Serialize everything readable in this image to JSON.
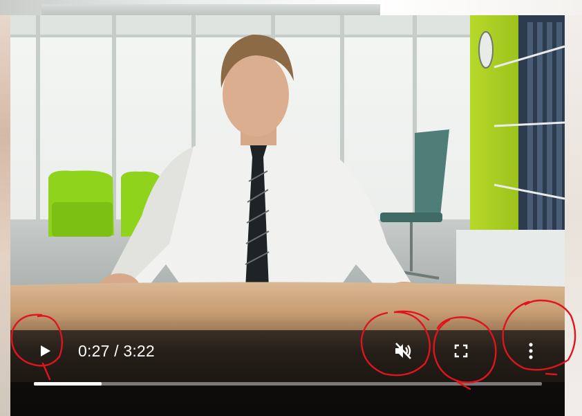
{
  "player": {
    "time_display": "0:27 / 3:22",
    "progress_fraction": 0.134,
    "state": "paused",
    "muted": true
  },
  "controls": {
    "play": {
      "icon": "play-icon"
    },
    "mute": {
      "icon": "volume-muted-icon"
    },
    "fullscreen": {
      "icon": "fullscreen-icon"
    },
    "more": {
      "icon": "more-vertical-icon"
    }
  },
  "annotations": {
    "color": "#e0141c",
    "circled": [
      "play-button",
      "mute-button",
      "fullscreen-button",
      "more-button"
    ]
  },
  "colors": {
    "control_fg": "#ffffff",
    "progress_track": "#bdbdbd",
    "progress_fill": "#ffffff"
  }
}
